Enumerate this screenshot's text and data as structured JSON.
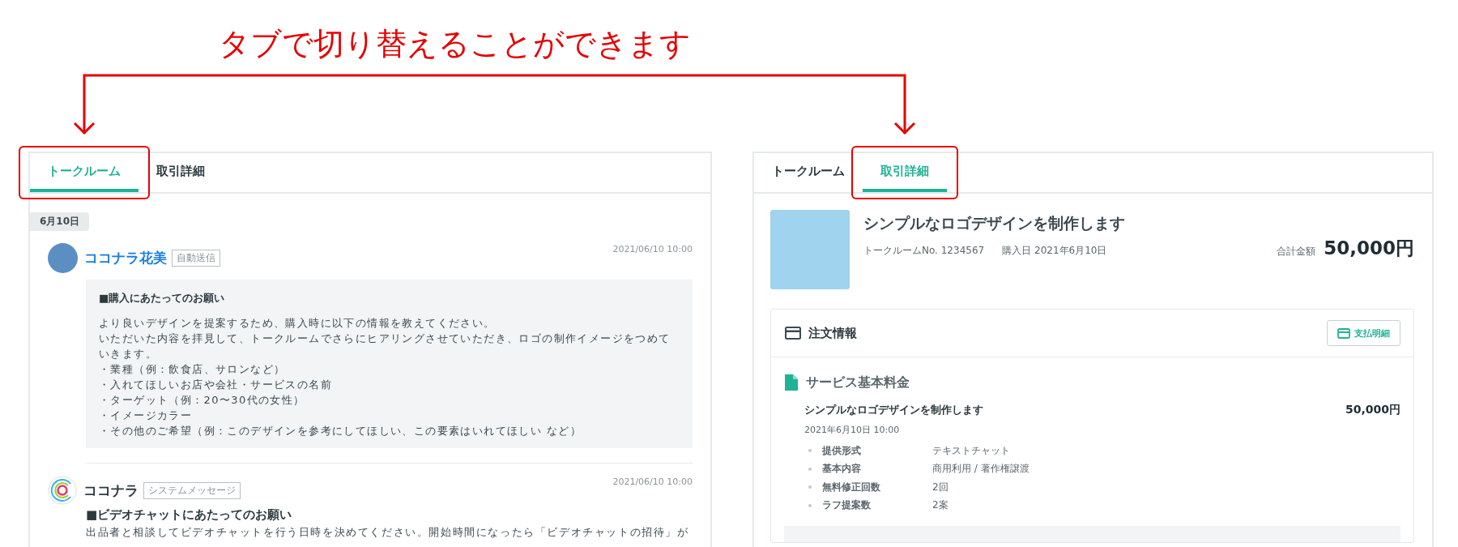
{
  "annotation": {
    "text": "タブで切り替えることができます"
  },
  "panels": [
    {
      "kind": "talk",
      "tabs": [
        {
          "label": "トークルーム",
          "selected": true
        },
        {
          "label": "取引詳細",
          "selected": false
        }
      ],
      "date_chip": "6月10日",
      "messages": [
        {
          "kind": "user",
          "sender": "ココナラ花美",
          "badge": "自動送信",
          "time": "2021/06/10 10:00",
          "heading": "■購入にあたってのお願い",
          "lines": [
            "より良いデザインを提案するため、購入時に以下の情報を教えてください。",
            "いただいた内容を拝見して、トークルームでさらにヒアリングさせていただき、ロゴの制作イメージをつめていきます。",
            "・業種（例：飲食店、サロンなど）",
            "・入れてほしいお店や会社・サービスの名前",
            "・ターゲット（例：20〜30代の女性）",
            "・イメージカラー",
            "・その他のご希望（例：このデザインを参考にしてほしい、この要素はいれてほしい など）"
          ]
        },
        {
          "kind": "system",
          "sender": "ココナラ",
          "badge": "システムメッセージ",
          "time": "2021/06/10 10:00",
          "heading": "■ビデオチャットにあたってのお願い",
          "lines": [
            "出品者と相談してビデオチャットを行う日時を決めてください。開始時間になったら「ビデオチャットの招待」が"
          ]
        }
      ]
    },
    {
      "kind": "detail",
      "tabs": [
        {
          "label": "トークルーム",
          "selected": false
        },
        {
          "label": "取引詳細",
          "selected": true
        }
      ],
      "service": {
        "title": "シンプルなロゴデザインを制作します",
        "room_no": "トークルームNo. 1234567",
        "purchase_date": "購入日 2021年6月10日",
        "total_label": "合計金額",
        "total": "50,000円"
      },
      "order": {
        "title": "注文情報",
        "button": "支払明細",
        "section": "サービス基本料金",
        "item": {
          "title": "シンプルなロゴデザインを制作します",
          "price": "50,000円",
          "date": "2021年6月10日 10:00",
          "specs": [
            {
              "label": "提供形式",
              "value": "テキストチャット"
            },
            {
              "label": "基本内容",
              "value": "商用利用 / 著作権譲渡"
            },
            {
              "label": "無料修正回数",
              "value": "2回"
            },
            {
              "label": "ラフ提案数",
              "value": "2案"
            }
          ]
        }
      }
    }
  ]
}
